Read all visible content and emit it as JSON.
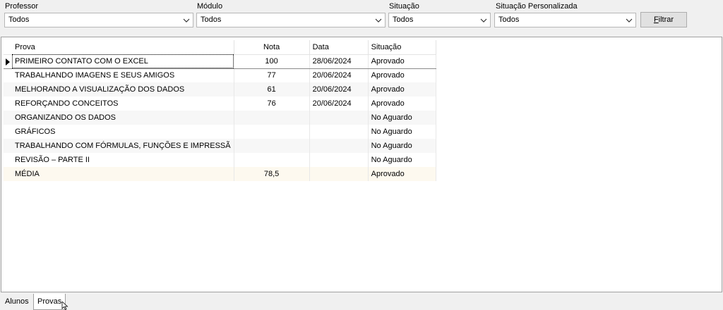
{
  "filters": {
    "professor": {
      "label": "Professor",
      "value": "Todos"
    },
    "modulo": {
      "label": "Módulo",
      "value": "Todos"
    },
    "situacao": {
      "label": "Situação",
      "value": "Todos"
    },
    "situacao_personalizada": {
      "label": "Situação Personalizada",
      "value": "Todos"
    },
    "filter_button": {
      "label_hotkey": "F",
      "label_rest": "iltrar"
    }
  },
  "grid": {
    "columns": {
      "prova": "Prova",
      "nota": "Nota",
      "data": "Data",
      "situacao": "Situação"
    },
    "rows": [
      {
        "prova": "PRIMEIRO CONTATO COM  O EXCEL",
        "nota": "100",
        "data": "28/06/2024",
        "situacao": "Aprovado"
      },
      {
        "prova": "TRABALHANDO IMAGENS E SEUS AMIGOS",
        "nota": "77",
        "data": "20/06/2024",
        "situacao": "Aprovado"
      },
      {
        "prova": "MELHORANDO A VISUALIZAÇÃO DOS DADOS",
        "nota": "61",
        "data": "20/06/2024",
        "situacao": "Aprovado"
      },
      {
        "prova": "REFORÇANDO CONCEITOS",
        "nota": "76",
        "data": "20/06/2024",
        "situacao": "Aprovado"
      },
      {
        "prova": "ORGANIZANDO OS DADOS",
        "nota": "",
        "data": "",
        "situacao": "No Aguardo"
      },
      {
        "prova": "GRÁFICOS",
        "nota": "",
        "data": "",
        "situacao": "No Aguardo"
      },
      {
        "prova": "TRABALHANDO COM FÓRMULAS, FUNÇÕES E IMPRESSÃ",
        "nota": "",
        "data": "",
        "situacao": "No Aguardo"
      },
      {
        "prova": "REVISÃO – PARTE II",
        "nota": "",
        "data": "",
        "situacao": "No Aguardo"
      },
      {
        "prova": "MÉDIA",
        "nota": "78,5",
        "data": "",
        "situacao": "Aprovado"
      }
    ]
  },
  "tabs": [
    {
      "label": "Alunos",
      "active": false
    },
    {
      "label": "Provas",
      "active": true
    }
  ]
}
